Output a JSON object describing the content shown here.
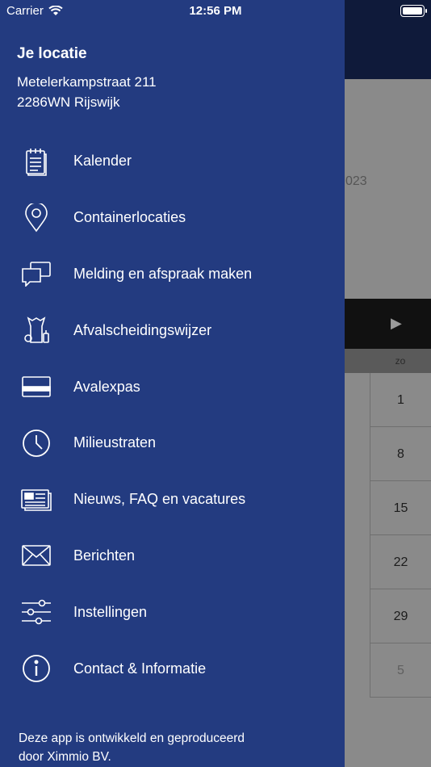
{
  "status_bar": {
    "carrier": "Carrier",
    "time": "12:56 PM"
  },
  "location": {
    "title": "Je locatie",
    "street": "Metelerkampstraat 211",
    "postal_city": "2286WN Rijswijk"
  },
  "menu": {
    "items": [
      {
        "label": "Kalender",
        "icon": "calendar-list-icon"
      },
      {
        "label": "Containerlocaties",
        "icon": "map-pin-icon"
      },
      {
        "label": "Melding en afspraak maken",
        "icon": "chat-bubbles-icon"
      },
      {
        "label": "Afvalscheidingswijzer",
        "icon": "waste-sorting-icon"
      },
      {
        "label": "Avalexpas",
        "icon": "card-icon"
      },
      {
        "label": "Milieustraten",
        "icon": "clock-icon"
      },
      {
        "label": "Nieuws, FAQ en vacatures",
        "icon": "newspaper-icon"
      },
      {
        "label": "Berichten",
        "icon": "envelope-icon"
      },
      {
        "label": "Instellingen",
        "icon": "sliders-icon"
      },
      {
        "label": "Contact & Informatie",
        "icon": "info-icon"
      }
    ]
  },
  "footer": {
    "line1": "Deze app is ontwikkeld en geproduceerd",
    "line2": "door Ximmio BV."
  },
  "background": {
    "year_fragment": "023",
    "weekday_header": "zo",
    "sunday_dates": [
      "1",
      "8",
      "15",
      "22",
      "29",
      "5"
    ]
  },
  "colors": {
    "drawer": "#233b80",
    "header": "#0f1a3a"
  }
}
